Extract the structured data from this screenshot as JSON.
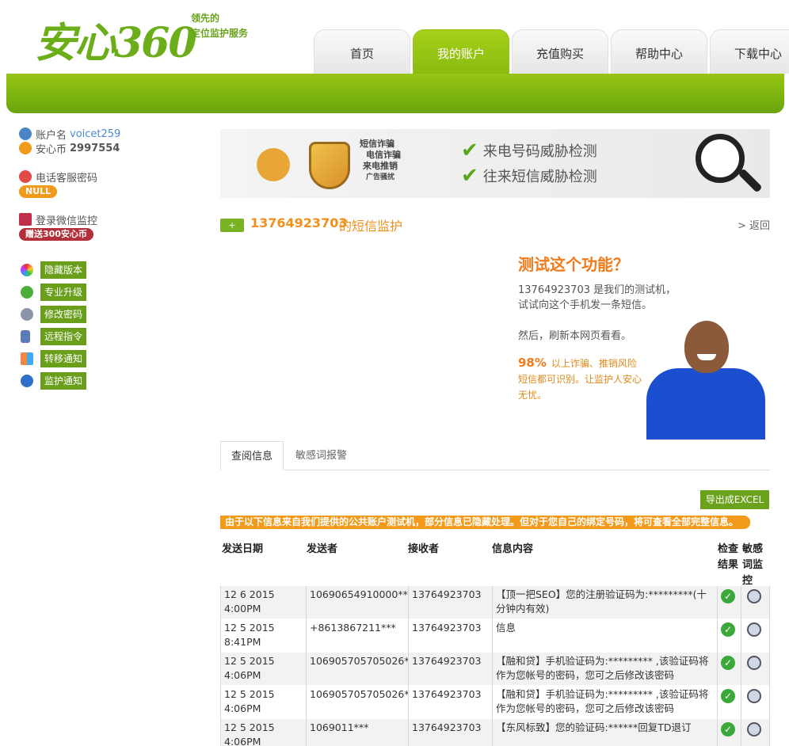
{
  "header": {
    "logo_text": "安心360",
    "slogan_line1": "领先的",
    "slogan_line2": "定位监护服务",
    "nav": [
      {
        "label": "首页",
        "active": false
      },
      {
        "label": "我的账户",
        "active": true
      },
      {
        "label": "充值购买",
        "active": false
      },
      {
        "label": "帮助中心",
        "active": false
      },
      {
        "label": "下载中心",
        "active": false
      }
    ]
  },
  "sidebar": {
    "account_label": "账户名",
    "account_value": "voicet259",
    "coin_label": "安心币",
    "coin_value": "2997554",
    "phone_pwd_label": "电话客服密码",
    "phone_pwd_value": "NULL",
    "wechat_label": "登录微信监控",
    "wechat_bonus": "赠送300安心币",
    "menu": [
      {
        "label": "隐藏版本",
        "icon": "palette-icon"
      },
      {
        "label": "专业升级",
        "icon": "plus-icon"
      },
      {
        "label": "修改密码",
        "icon": "gear-icon"
      },
      {
        "label": "远程指令",
        "icon": "phone-icon"
      },
      {
        "label": "转移通知",
        "icon": "grid-icon"
      },
      {
        "label": "监护通知",
        "icon": "globe-icon"
      }
    ]
  },
  "banner": {
    "tags": [
      "短信诈骗",
      "电信诈骗",
      "来电推销",
      "广告骚扰"
    ],
    "check1": "来电号码威胁检测",
    "check2": "往来短信威胁检测"
  },
  "title": {
    "number": "13764923703",
    "suffix": "的短信监护",
    "back": "> 返回"
  },
  "try": {
    "title": "测试这个功能？",
    "line1": "13764923703  是我们的测试机，",
    "line2": "试试向这个手机发一条短信。",
    "line3": "然后，刷新本网页看看。",
    "percent": "98%",
    "percent_text": "以上诈骗、推销风险短信都可识别。让监护人安心无忧。"
  },
  "tabs": [
    {
      "label": "查阅信息",
      "active": true
    },
    {
      "label": "敏感词报警",
      "active": false
    }
  ],
  "export_label": "导出成EXCEL",
  "notice": "由于以下信息来自我们提供的公共账户测试机，部分信息已隐藏处理。但对于您自己的绑定号码，将可查看全部完整信息。",
  "table": {
    "headers": [
      "发送日期",
      "发送者",
      "接收者",
      "信息内容",
      "检查结果",
      "敏感词监控"
    ],
    "rows": [
      {
        "date": "12 6 2015 4:00PM",
        "sender": "10690654910000***",
        "receiver": "13764923703",
        "message": "【顶一把SEO】您的注册验证码为:*********(十分钟内有效)"
      },
      {
        "date": "12 5 2015 8:41PM",
        "sender": "+8613867211***",
        "receiver": "13764923703",
        "message": "信息"
      },
      {
        "date": "12 5 2015 4:06PM",
        "sender": "106905705705026***",
        "receiver": "13764923703",
        "message": "【融和贷】手机验证码为:********* ,该验证码将作为您帐号的密码，您可之后修改该密码"
      },
      {
        "date": "12 5 2015 4:06PM",
        "sender": "106905705705026***",
        "receiver": "13764923703",
        "message": "【融和贷】手机验证码为:********* ,该验证码将作为您帐号的密码，您可之后修改该密码"
      },
      {
        "date": "12 5 2015 4:06PM",
        "sender": "1069011***",
        "receiver": "13764923703",
        "message": "【东风标致】您的验证码:******回复TD退订"
      }
    ]
  }
}
